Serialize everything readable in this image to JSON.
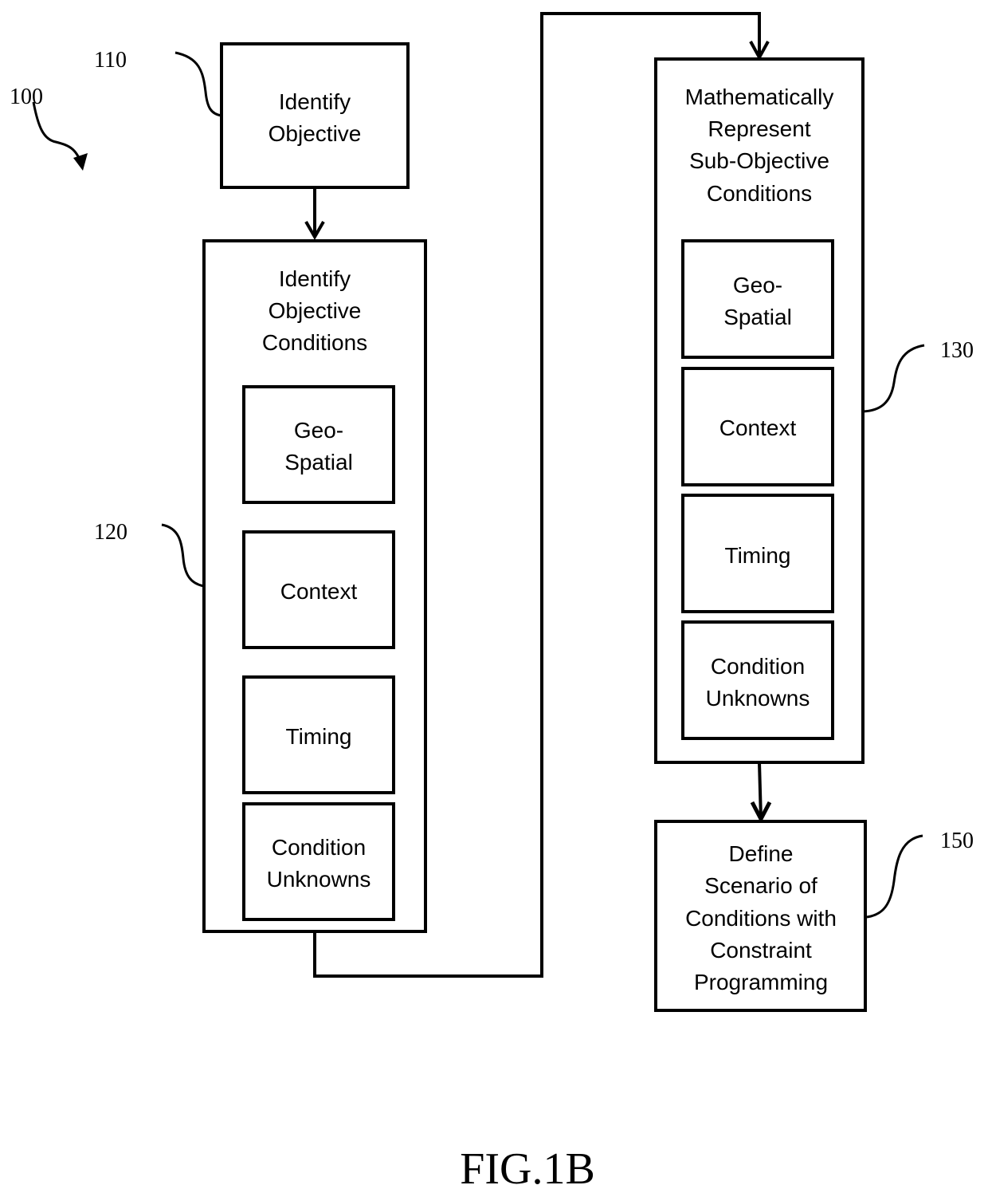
{
  "figure_label": "FIG.1B",
  "refs": {
    "r100": "100",
    "r110": "110",
    "r120": "120",
    "r130": "130",
    "r150": "150"
  },
  "step110": {
    "lines": [
      "Identify",
      "Objective"
    ]
  },
  "step120": {
    "title_lines": [
      "Identify",
      "Objective",
      "Conditions"
    ],
    "items": [
      {
        "lines": [
          "Geo-",
          "Spatial"
        ]
      },
      {
        "lines": [
          "Context"
        ]
      },
      {
        "lines": [
          "Timing"
        ]
      },
      {
        "lines": [
          "Condition",
          "Unknowns"
        ]
      }
    ]
  },
  "step130": {
    "title_lines": [
      "Mathematically",
      "Represent",
      "Sub-Objective",
      "Conditions"
    ],
    "items": [
      {
        "lines": [
          "Geo-",
          "Spatial"
        ]
      },
      {
        "lines": [
          "Context"
        ]
      },
      {
        "lines": [
          "Timing"
        ]
      },
      {
        "lines": [
          "Condition",
          "Unknowns"
        ]
      }
    ]
  },
  "step150": {
    "lines": [
      "Define",
      "Scenario of",
      "Conditions with",
      "Constraint",
      "Programming"
    ]
  }
}
